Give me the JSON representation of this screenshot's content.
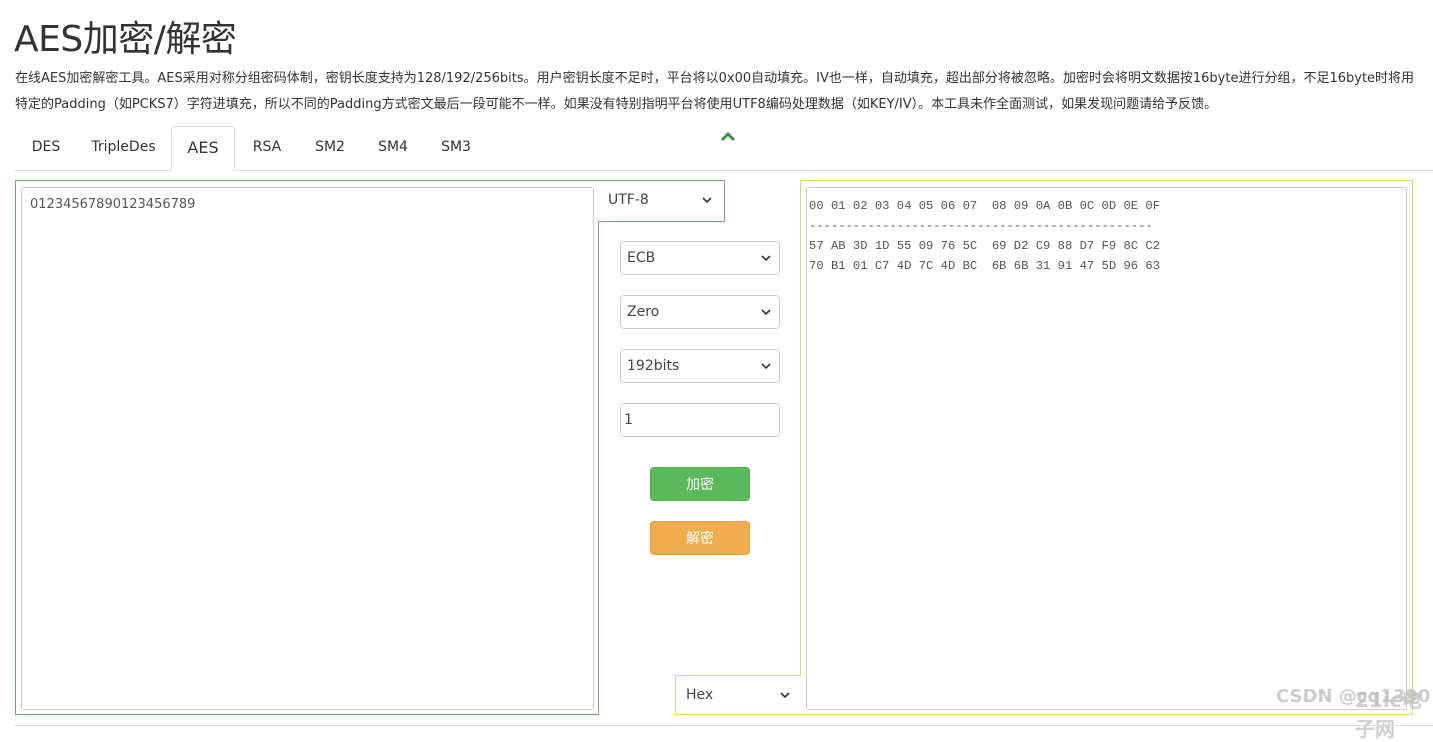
{
  "page": {
    "title": "AES加密/解密",
    "description": "在线AES加密解密工具。AES采用对称分组密码体制，密钥长度支持为128/192/256bits。用户密钥长度不足时，平台将以0x00自动填充。IV也一样，自动填充，超出部分将被忽略。加密时会将明文数据按16byte进行分组，不足16byte时将用特定的Padding（如PCKS7）字符进填充，所以不同的Padding方式密文最后一段可能不一样。如果没有特别指明平台将使用UTF8编码处理数据（如KEY/IV）。本工具未作全面测试，如果发现问题请给予反馈。"
  },
  "tabs": [
    {
      "label": "DES",
      "active": false
    },
    {
      "label": "TripleDes",
      "active": false
    },
    {
      "label": "AES",
      "active": true
    },
    {
      "label": "RSA",
      "active": false
    },
    {
      "label": "SM2",
      "active": false
    },
    {
      "label": "SM4",
      "active": false
    },
    {
      "label": "SM3",
      "active": false
    }
  ],
  "icons": {
    "collapse": "chevron-up-icon",
    "dropdown": "chevron-down-icon"
  },
  "colors": {
    "green_accent": "#5cb85c",
    "orange_accent": "#f0ad4e",
    "left_border": "#6aa86a",
    "right_border": "#e7d56a"
  },
  "input": {
    "plaintext": "01234567890123456789",
    "encoding": "UTF-8"
  },
  "controls": {
    "mode": "ECB",
    "padding": "Zero",
    "key_size": "192bits",
    "key": "1",
    "encrypt_label": "加密",
    "decrypt_label": "解密"
  },
  "output": {
    "format": "Hex",
    "header": "00 01 02 03 04 05 06 07  08 09 0A 0B 0C 0D 0E 0F",
    "separator": "-----------------------------------------------",
    "lines": [
      "57 AB 3D 1D 55 09 76 5C  69 D2 C9 88 D7 F9 8C C2",
      "70 B1 01 C7 4D 7C 4D BC  6B 6B 31 91 47 5D 96 63"
    ]
  },
  "watermark": {
    "text": "CSDN @cq1390",
    "logo": "21ic电子网"
  }
}
